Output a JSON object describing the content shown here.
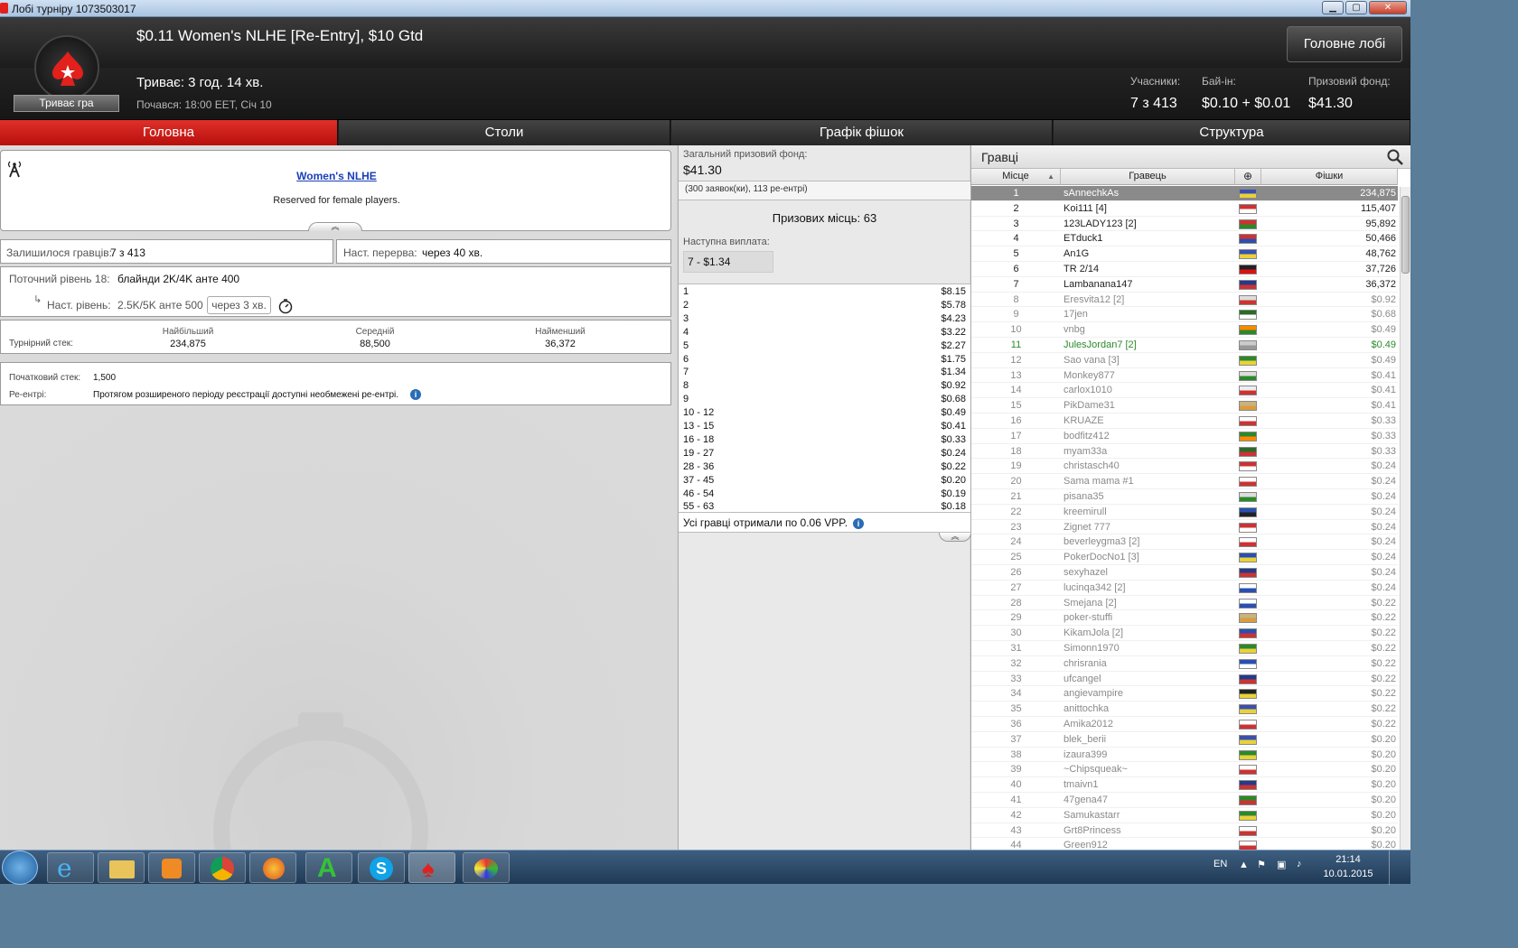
{
  "window": {
    "title": "Лобі турніру 1073503017",
    "min": "▁",
    "max": "▢",
    "close": "✕"
  },
  "header": {
    "title": "$0.11 Women's NLHE [Re-Entry], $10 Gtd",
    "running": "Триває: 3 год. 14 хв.",
    "started": "Почався: 18:00 EET, Січ 10",
    "status": "Триває гра",
    "lobby_button": "Головне лобі",
    "entrants_label": "Учасники:",
    "entrants_value": "7 з 413",
    "buyin_label": "Бай-ін:",
    "buyin_value": "$0.10 + $0.01",
    "prize_label": "Призовий фонд:",
    "prize_value": "$41.30"
  },
  "tabs": [
    "Головна",
    "Столи",
    "Графік фішок",
    "Структура"
  ],
  "info": {
    "link": "Women's NLHE",
    "text": "Reserved for female players.",
    "remaining_label": "Залишилося гравців:",
    "remaining_value": "7 з 413",
    "break_label": "Наст. перерва:",
    "break_value": "через 40 хв.",
    "level_label": "Поточний рівень 18:",
    "level_value": "блайнди 2K/4K анте 400",
    "next_label": "Наст. рівень:",
    "next_value": "2.5K/5K анте 500",
    "next_time": "через 3 хв.",
    "stack_label": "Турнірний стек:",
    "largest_label": "Найбільший",
    "largest_value": "234,875",
    "average_label": "Середній",
    "average_value": "88,500",
    "smallest_label": "Найменший",
    "smallest_value": "36,372",
    "start_stack_label": "Початковий стек:",
    "start_stack_value": "1,500",
    "reentry_label": "Ре-ентрі:",
    "reentry_value": "Протягом розширеного періоду реєстрації доступні необмежені ре-ентрі."
  },
  "prize": {
    "pool_label": "Загальний призовий фонд:",
    "pool_value": "$41.30",
    "entries": "(300 заявок(ки), 113 ре-ентрі)",
    "places": "Призових місць: 63",
    "next_label": "Наступна виплата:",
    "next_value": "7 - $1.34",
    "table": [
      [
        "1",
        "$8.15"
      ],
      [
        "2",
        "$5.78"
      ],
      [
        "3",
        "$4.23"
      ],
      [
        "4",
        "$3.22"
      ],
      [
        "5",
        "$2.27"
      ],
      [
        "6",
        "$1.75"
      ],
      [
        "7",
        "$1.34"
      ],
      [
        "8",
        "$0.92"
      ],
      [
        "9",
        "$0.68"
      ],
      [
        "10 - 12",
        "$0.49"
      ],
      [
        "13 - 15",
        "$0.41"
      ],
      [
        "16 - 18",
        "$0.33"
      ],
      [
        "19 - 27",
        "$0.24"
      ],
      [
        "28 - 36",
        "$0.22"
      ],
      [
        "37 - 45",
        "$0.20"
      ],
      [
        "46 - 54",
        "$0.19"
      ],
      [
        "55 - 63",
        "$0.18"
      ]
    ],
    "vpp": "Усі гравці отримали по 0.06 VPP."
  },
  "players": {
    "title": "Гравці",
    "col_rank": "Місце",
    "col_player": "Гравець",
    "col_chips": "Фішки",
    "rows": [
      {
        "r": "1",
        "n": "sAnnechkAs",
        "c": "234,875",
        "f": [
          "#3a4fb0",
          "#e8d23a"
        ]
      },
      {
        "r": "2",
        "n": "Koi111 [4]",
        "c": "115,407",
        "f": [
          "#c33",
          "#fff"
        ]
      },
      {
        "r": "3",
        "n": "123LADY123 [2]",
        "c": "95,892",
        "f": [
          "#c33",
          "#2a8a2a"
        ]
      },
      {
        "r": "4",
        "n": "ETduck1",
        "c": "50,466",
        "f": [
          "#c33",
          "#2a4fb0"
        ]
      },
      {
        "r": "5",
        "n": "An1G",
        "c": "48,762",
        "f": [
          "#3a4fb0",
          "#e8d23a"
        ]
      },
      {
        "r": "6",
        "n": "TR 2/14",
        "c": "37,726",
        "f": [
          "#222",
          "#d11"
        ]
      },
      {
        "r": "7",
        "n": "Lambanana147",
        "c": "36,372",
        "f": [
          "#233a8a",
          "#c33"
        ]
      },
      {
        "r": "8",
        "n": "Eresvita12 [2]",
        "c": "$0.92",
        "f": [
          "#ddd",
          "#c33"
        ]
      },
      {
        "r": "9",
        "n": "17jen",
        "c": "$0.68",
        "f": [
          "#2a6a2a",
          "#fff"
        ]
      },
      {
        "r": "10",
        "n": "vnbg",
        "c": "$0.49",
        "f": [
          "#f80",
          "#2a8a2a"
        ]
      },
      {
        "r": "11",
        "n": "JulesJordan7 [2]",
        "c": "$0.49",
        "f": [
          "#ccc",
          "#999"
        ]
      },
      {
        "r": "12",
        "n": "Sao vana [3]",
        "c": "$0.49",
        "f": [
          "#2a8a2a",
          "#e8d23a"
        ]
      },
      {
        "r": "13",
        "n": "Monkey877",
        "c": "$0.41",
        "f": [
          "#ddd",
          "#2a8a2a"
        ]
      },
      {
        "r": "14",
        "n": "carlox1010",
        "c": "$0.41",
        "f": [
          "#eee",
          "#c33"
        ]
      },
      {
        "r": "15",
        "n": "PikDame31",
        "c": "$0.41",
        "f": [
          "#c9b37a",
          "#d89c44"
        ]
      },
      {
        "r": "16",
        "n": "KRUAZE",
        "c": "$0.33",
        "f": [
          "#fff",
          "#c33"
        ]
      },
      {
        "r": "17",
        "n": "bodfitz412",
        "c": "$0.33",
        "f": [
          "#2a8a2a",
          "#f80"
        ]
      },
      {
        "r": "18",
        "n": "myam33a",
        "c": "$0.33",
        "f": [
          "#2a6a2a",
          "#c33"
        ]
      },
      {
        "r": "19",
        "n": "christasch40",
        "c": "$0.24",
        "f": [
          "#c33",
          "#fff"
        ]
      },
      {
        "r": "20",
        "n": "Sama mama #1",
        "c": "$0.24",
        "f": [
          "#fff",
          "#c33"
        ]
      },
      {
        "r": "21",
        "n": "pisana35",
        "c": "$0.24",
        "f": [
          "#ddd",
          "#2a8a2a"
        ]
      },
      {
        "r": "22",
        "n": "kreemirull",
        "c": "$0.24",
        "f": [
          "#2a4fb0",
          "#222"
        ]
      },
      {
        "r": "23",
        "n": "Zignet 777",
        "c": "$0.24",
        "f": [
          "#c33",
          "#fff"
        ]
      },
      {
        "r": "24",
        "n": "beverleygma3 [2]",
        "c": "$0.24",
        "f": [
          "#fff",
          "#c33"
        ]
      },
      {
        "r": "25",
        "n": "PokerDocNo1 [3]",
        "c": "$0.24",
        "f": [
          "#2a4fb0",
          "#e8d23a"
        ]
      },
      {
        "r": "26",
        "n": "sexyhazel",
        "c": "$0.24",
        "f": [
          "#233a8a",
          "#c33"
        ]
      },
      {
        "r": "27",
        "n": "lucinqa342 [2]",
        "c": "$0.24",
        "f": [
          "#fff",
          "#2a4fb0"
        ]
      },
      {
        "r": "28",
        "n": "Smejana [2]",
        "c": "$0.22",
        "f": [
          "#fff",
          "#2a4fb0"
        ]
      },
      {
        "r": "29",
        "n": "poker-stuffi",
        "c": "$0.22",
        "f": [
          "#c9b37a",
          "#d89c44"
        ]
      },
      {
        "r": "30",
        "n": "KikamJola [2]",
        "c": "$0.22",
        "f": [
          "#2a4fb0",
          "#c33"
        ]
      },
      {
        "r": "31",
        "n": "Simonn1970",
        "c": "$0.22",
        "f": [
          "#2a8a2a",
          "#e8d23a"
        ]
      },
      {
        "r": "32",
        "n": "chrisrania",
        "c": "$0.22",
        "f": [
          "#2a4fb0",
          "#fff"
        ]
      },
      {
        "r": "33",
        "n": "ufcangel",
        "c": "$0.22",
        "f": [
          "#233a8a",
          "#c33"
        ]
      },
      {
        "r": "34",
        "n": "angievampire",
        "c": "$0.22",
        "f": [
          "#222",
          "#e8d23a"
        ]
      },
      {
        "r": "35",
        "n": "anittochka",
        "c": "$0.22",
        "f": [
          "#3a4fb0",
          "#e8d23a"
        ]
      },
      {
        "r": "36",
        "n": "Amika2012",
        "c": "$0.22",
        "f": [
          "#fff",
          "#c33"
        ]
      },
      {
        "r": "37",
        "n": "blek_berii",
        "c": "$0.20",
        "f": [
          "#3a4fb0",
          "#e8d23a"
        ]
      },
      {
        "r": "38",
        "n": "izaura399",
        "c": "$0.20",
        "f": [
          "#2a8a2a",
          "#e8d23a"
        ]
      },
      {
        "r": "39",
        "n": "~Chipsqueak~",
        "c": "$0.20",
        "f": [
          "#fff",
          "#c33"
        ]
      },
      {
        "r": "40",
        "n": "tmaivn1",
        "c": "$0.20",
        "f": [
          "#233a8a",
          "#c33"
        ]
      },
      {
        "r": "41",
        "n": "47gena47",
        "c": "$0.20",
        "f": [
          "#2a8a2a",
          "#c33"
        ]
      },
      {
        "r": "42",
        "n": "Samukastarr",
        "c": "$0.20",
        "f": [
          "#2a8a2a",
          "#e8d23a"
        ]
      },
      {
        "r": "43",
        "n": "Grt8Princess",
        "c": "$0.20",
        "f": [
          "#fff",
          "#c33"
        ]
      },
      {
        "r": "44",
        "n": "Green912",
        "c": "$0.20",
        "f": [
          "#fff",
          "#c33"
        ]
      }
    ]
  },
  "taskbar": {
    "lang": "EN",
    "time": "21:14",
    "date": "10.01.2015"
  }
}
